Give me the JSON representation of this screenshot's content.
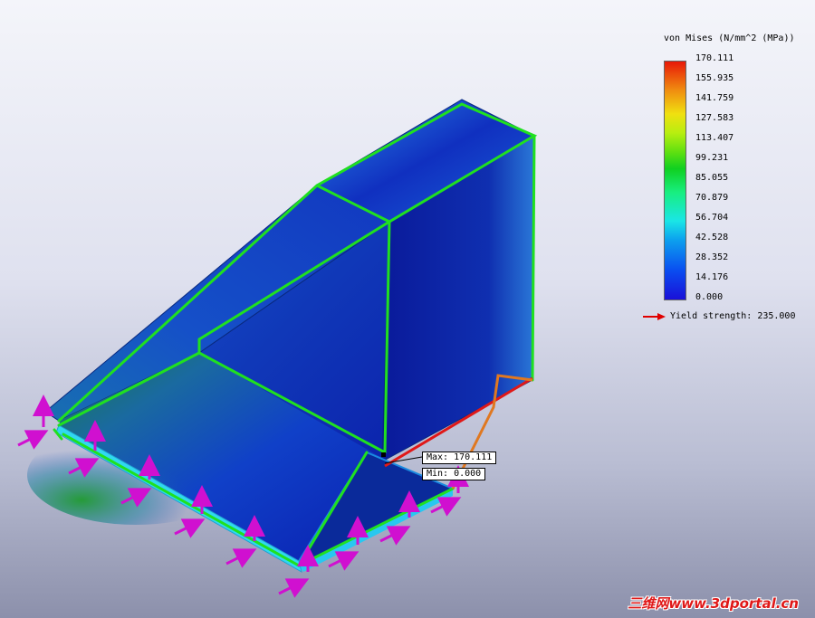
{
  "legend": {
    "title": "von Mises (N/mm^2 (MPa))",
    "ticks": [
      "170.111",
      "155.935",
      "141.759",
      "127.583",
      "113.407",
      "99.231",
      "85.055",
      "70.879",
      "56.704",
      "42.528",
      "28.352",
      "14.176",
      "0.000"
    ],
    "yield_label": "Yield strength: 235.000",
    "yield_arrow_color": "#e00000"
  },
  "probes": {
    "max_label": "Max: 170.111",
    "min_label": "Min: 0.000"
  },
  "watermark": "三维网www.3dportal.cn",
  "colors": {
    "frame_lines": "#20e020",
    "load_arrows": "#d010d0",
    "peak_member": "#e01818"
  },
  "icons": {
    "yield_arrow": "right-arrow-icon",
    "load_arrow": "force-arrow-icon"
  }
}
